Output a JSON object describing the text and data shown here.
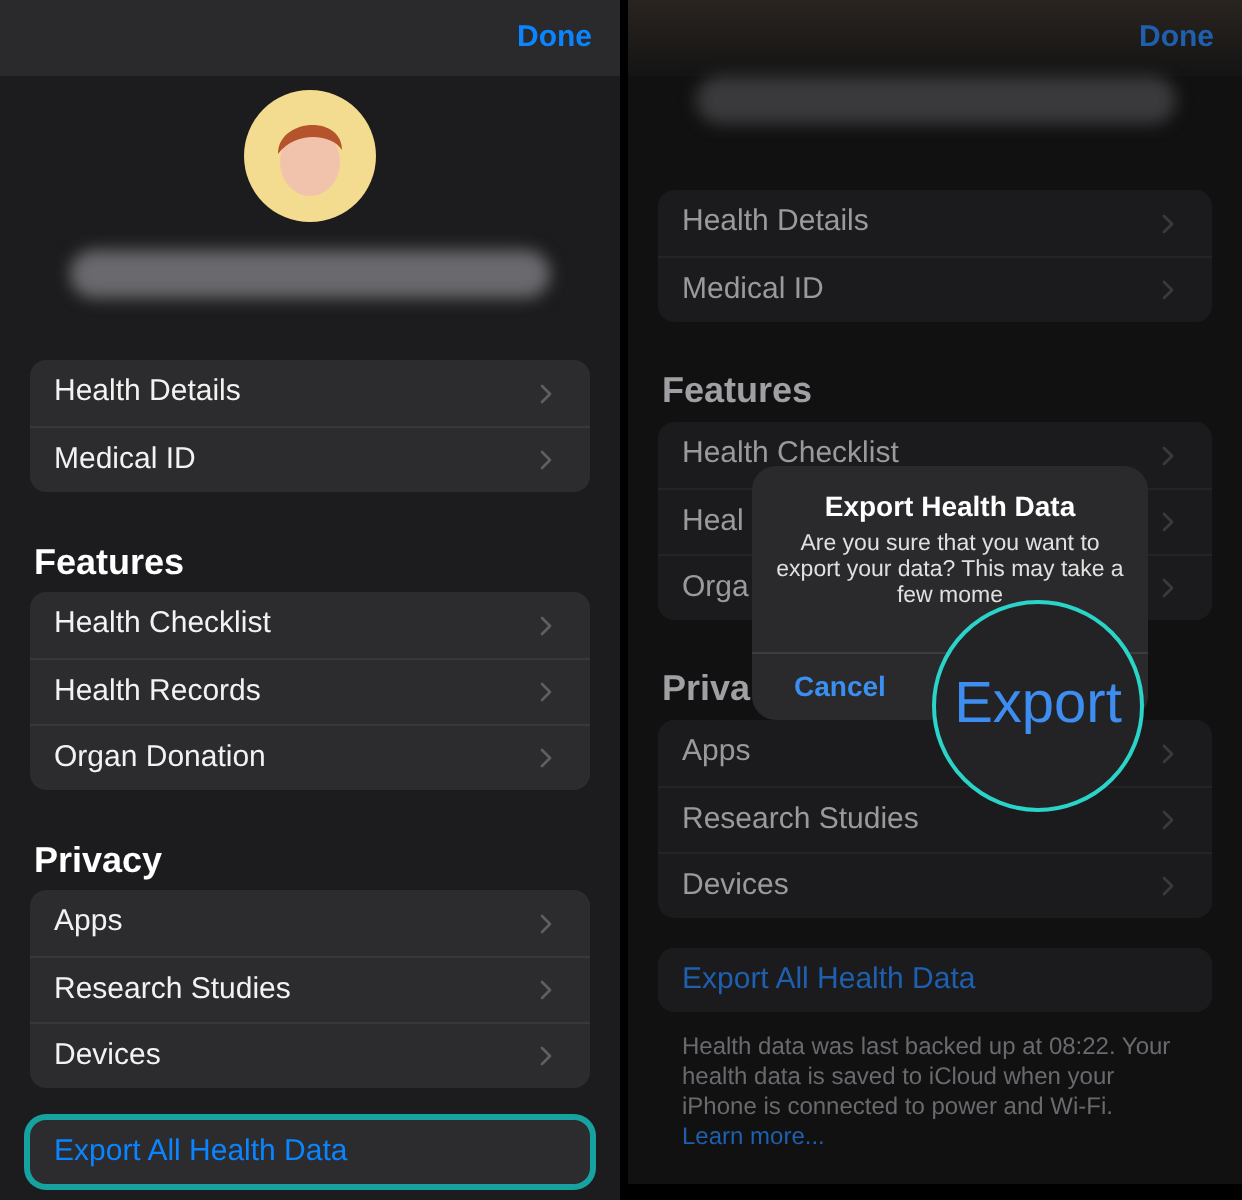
{
  "left_screen": {
    "dimmed": false,
    "done_button": "Done",
    "sections": [
      {
        "rows": [
          "Health Details",
          "Medical ID"
        ]
      },
      {
        "title": "Features",
        "rows": [
          "Health Checklist",
          "Health Records",
          "Organ Donation"
        ]
      },
      {
        "title": "Privacy",
        "rows": [
          "Apps",
          "Research Studies",
          "Devices"
        ]
      }
    ],
    "export_button": {
      "label": "Export All Health Data",
      "highlighted": true
    }
  },
  "right_screen": {
    "dimmed": true,
    "done_button": "Done",
    "sections": [
      {
        "rows": [
          "Health Details",
          "Medical ID"
        ]
      },
      {
        "title": "Features",
        "rows": [
          "Health Checklist",
          "Heal",
          "Orga"
        ]
      },
      {
        "title": "Priva",
        "rows": [
          "Apps",
          "Research Studies",
          "Devices"
        ]
      }
    ],
    "export_button": {
      "label": "Export All Health Data",
      "highlighted": false
    },
    "footer": {
      "text": "Health data was last backed up at 08:22. Your health data is saved to iCloud when your iPhone is connected to power and Wi-Fi.",
      "link": "Learn more..."
    },
    "alert": {
      "title": "Export Health Data",
      "message": "Are you sure that you want to export your data? This may take a few mome",
      "cancel_button": "Cancel"
    },
    "magnifier": {
      "label": "Export"
    }
  }
}
